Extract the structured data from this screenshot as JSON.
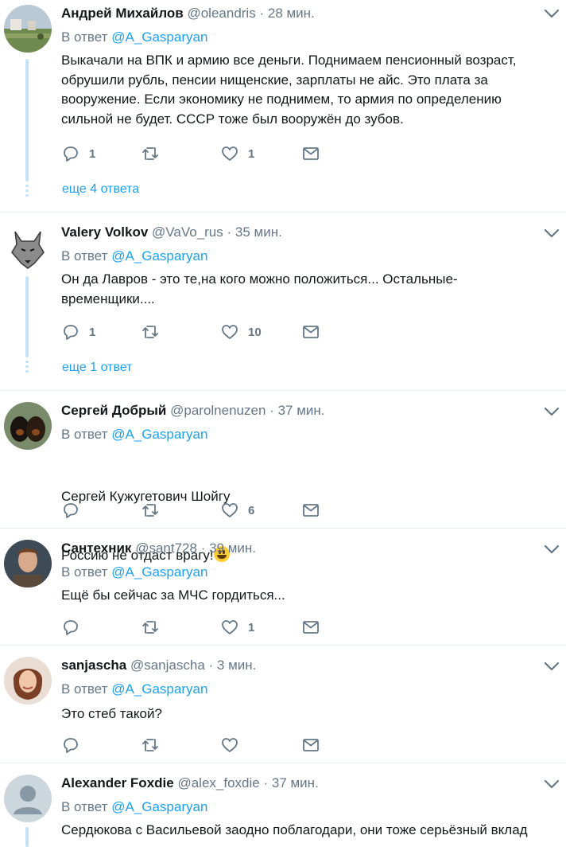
{
  "colors": {
    "link": "#1da1f2",
    "muted": "#657786",
    "text": "#14171a",
    "divider": "#e6ecf0",
    "thread": "#c4e3f8"
  },
  "icons": {
    "reply": "reply-icon",
    "retweet": "retweet-icon",
    "like": "like-icon",
    "dm": "direct-message-icon",
    "caret": "chevron-down-icon"
  },
  "tweets": [
    {
      "name": "Андрей Михайлов",
      "handle": "@oleandris",
      "sep": "·",
      "time": "28 мин.",
      "reply_prefix": "В ответ",
      "reply_to": "@A_Gasparyan",
      "text": "Выкачали на ВПК и армию все деньги. Поднимаем пенсионный возраст, обрушили рубль, пенсии нищенские, зарплаты не айс. Это плата за вооружение. Если экономику не поднимем, то армия по определению сильной не будет. СССР тоже был вооружён до зубов.",
      "replies": "1",
      "retweets": "",
      "likes": "1",
      "more": "еще 4 ответа"
    },
    {
      "name": "Valery Volkov",
      "handle": "@VaVo_rus",
      "sep": "·",
      "time": "35 мин.",
      "reply_prefix": "В ответ",
      "reply_to": "@A_Gasparyan",
      "text": "Он да Лавров - это те,на кого можно положиться... Остальные-временщики....",
      "replies": "1",
      "retweets": "",
      "likes": "10",
      "more": "еще 1 ответ"
    },
    {
      "name": "Сергей Добрый",
      "handle": "@parolnenuzen",
      "sep": "·",
      "time": "37 мин.",
      "reply_prefix": "В ответ",
      "reply_to": "@A_Gasparyan",
      "text_line1": "Сергей Кужугетович Шойгу",
      "text_line2": "Россию не отдаст врагу!",
      "replies": "",
      "retweets": "",
      "likes": "6"
    },
    {
      "name": "Сантехник",
      "handle": "@sant728",
      "sep": "·",
      "time": "39 мин.",
      "reply_prefix": "В ответ",
      "reply_to": "@A_Gasparyan",
      "text": "Ещё бы сейчас за МЧС гордиться...",
      "replies": "",
      "retweets": "",
      "likes": "1"
    },
    {
      "name": "sanjascha",
      "handle": "@sanjascha",
      "sep": "·",
      "time": "3 мин.",
      "reply_prefix": "В ответ",
      "reply_to": "@A_Gasparyan",
      "text": "Это стеб такой?",
      "replies": "",
      "retweets": "",
      "likes": ""
    },
    {
      "name": "Alexander Foxdie",
      "handle": "@alex_foxdie",
      "sep": "·",
      "time": "37 мин.",
      "reply_prefix": "В ответ",
      "reply_to": "@A_Gasparyan",
      "text": "Сердюкова с Васильевой заодно поблагодари, они тоже серьёзный вклад"
    }
  ]
}
